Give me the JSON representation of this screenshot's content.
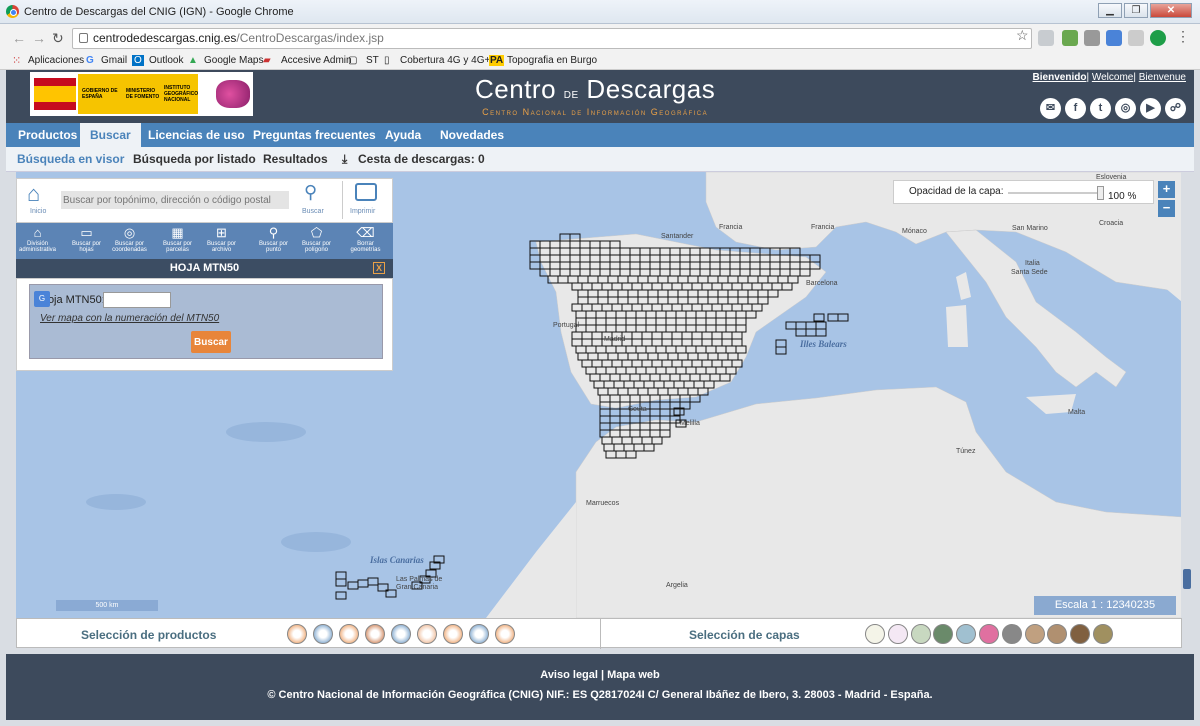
{
  "browser": {
    "window_title": "Centro de Descargas del CNIG (IGN) - Google Chrome",
    "url_host": "centrodedescargas.cnig.es",
    "url_path": "/CentroDescargas/index.jsp",
    "bookmarks": [
      "Aplicaciones",
      "Gmail",
      "Outlook",
      "Google Maps",
      "Accesive Admin",
      "ST",
      "Cobertura 4G y 4G+...",
      "Topografia en Burgo"
    ]
  },
  "header": {
    "gov_line1": "GOBIERNO DE ESPAÑA",
    "ministry": "MINISTERIO DE FOMENTO",
    "institute": "INSTITUTO GEOGRÁFICO NACIONAL",
    "brand_a": "Centro",
    "brand_de": "de",
    "brand_b": "Descargas",
    "subtitle": "Centro Nacional de Información Geográfica",
    "welcome": [
      "Bienvenido",
      "Welcome",
      "Bienvenue"
    ],
    "social": [
      "✉",
      "f",
      "t",
      "◎",
      "▶",
      "☍"
    ]
  },
  "menu": [
    "Productos",
    "Buscar",
    "Licencias de uso",
    "Preguntas frecuentes",
    "Ayuda",
    "Novedades"
  ],
  "submenu": {
    "visor": "Búsqueda en visor",
    "listado": "Búsqueda por listado",
    "resultados": "Resultados",
    "cesta": "Cesta de descargas: 0"
  },
  "search": {
    "inicio": "Inicio",
    "placeholder": "Buscar por topónimo, dirección o código postal",
    "buscar": "Buscar",
    "imprimir": "Imprimir"
  },
  "tools": [
    {
      "icon": "⌂",
      "label": "División administrativa"
    },
    {
      "icon": "▭",
      "label": "Buscar por hojas"
    },
    {
      "icon": "◎",
      "label": "Buscar por coordenadas"
    },
    {
      "icon": "▦",
      "label": "Buscar por parcelas"
    },
    {
      "icon": "⊞",
      "label": "Buscar por archivo"
    },
    {
      "icon": "⚲",
      "label": "Buscar por punto"
    },
    {
      "icon": "⬠",
      "label": "Buscar por polígono"
    },
    {
      "icon": "⌫",
      "label": "Borrar geometrías"
    }
  ],
  "hoja": {
    "title": "HOJA MTN50",
    "close": "X",
    "label": "Hoja MTN50:",
    "link": "Ver mapa con la numeración del MTN50",
    "button": "Buscar"
  },
  "opacity": {
    "label": "Opacidad de la capa:",
    "value": "100 %"
  },
  "zoom": {
    "in": "+",
    "out": "−"
  },
  "map": {
    "scale_bar": "500 km",
    "escala": "Escala 1 : 12340235",
    "labels": [
      {
        "t": "Francia"
      },
      {
        "t": "Francia"
      },
      {
        "t": "Mónaco"
      },
      {
        "t": "San Marino"
      },
      {
        "t": "Croacia"
      },
      {
        "t": "Eslovenia"
      },
      {
        "t": "Italia"
      },
      {
        "t": "Santa Sede"
      },
      {
        "t": "Portugal"
      },
      {
        "t": "Madrid"
      },
      {
        "t": "Ceuta"
      },
      {
        "t": "Melilla"
      },
      {
        "t": "Marruecos"
      },
      {
        "t": "Argelia"
      },
      {
        "t": "Túnez"
      },
      {
        "t": "Malta"
      },
      {
        "t": "Islas Canarias"
      },
      {
        "t": "Illes Balears"
      },
      {
        "t": "Santander"
      },
      {
        "t": "Barcelona"
      },
      {
        "t": "Las Palmas de Gran Canaria"
      }
    ]
  },
  "bottom": {
    "productos": "Selección de productos",
    "capas": "Selección de capas"
  },
  "footer": {
    "aviso": "Aviso legal | Mapa web",
    "copy": "© Centro Nacional de Información Geográfica (CNIG) NIF.: ES Q2817024I C/ General Ibáñez de Ibero, 3. 28003 - Madrid - España."
  }
}
